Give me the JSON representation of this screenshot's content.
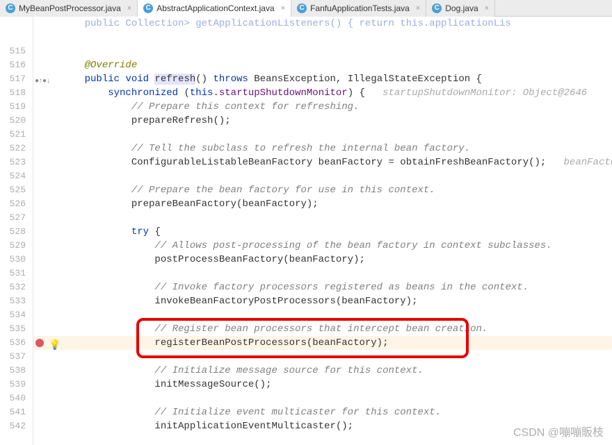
{
  "tabs": [
    {
      "label": "MyBeanPostProcessor.java",
      "active": false
    },
    {
      "label": "AbstractApplicationContext.java",
      "active": true
    },
    {
      "label": "FanfuApplicationTests.java",
      "active": false
    },
    {
      "label": "Dog.java",
      "active": false
    }
  ],
  "lines": {
    "start": 515,
    "end": 542
  },
  "code": {
    "l513_partial": "public Collection<ApplicationListener<?>> getApplicationListeners() { return this.applicationLis",
    "ann_override": "@Override",
    "refresh_sig_pre": "public void ",
    "refresh_word": "refresh",
    "refresh_sig_post": "() throws BeansException, IllegalStateException {",
    "sync_pre": "synchronized (",
    "sync_this": "this",
    "sync_field": ".startupShutdownMonitor",
    "sync_post": ") {",
    "sync_hint": "   startupShutdownMonitor: Object@2646",
    "c_prepare_ctx": "// Prepare this context for refreshing.",
    "prepareRefresh": "prepareRefresh();",
    "c_tell_subclass": "// Tell the subclass to refresh the internal bean factory.",
    "obtain_line": "ConfigurableListableBeanFactory beanFactory = obtainFreshBeanFactory();",
    "obtain_hint": "   beanFactory: \"o",
    "c_prepare_bf": "// Prepare the bean factory for use in this context.",
    "prepareBF": "prepareBeanFactory(beanFactory);",
    "try_kw": "try {",
    "c_allows": "// Allows post-processing of the bean factory in context subclasses.",
    "postProcessBF": "postProcessBeanFactory(beanFactory);",
    "c_invoke": "// Invoke factory processors registered as beans in the context.",
    "invokeBF": "invokeBeanFactoryPostProcessors(beanFactory);",
    "c_register": "// Register bean processors that intercept bean creation.",
    "registerBPP": "registerBeanPostProcessors(beanFactory);",
    "c_initmsg": "// Initialize message source for this context.",
    "initMsg": "initMessageSource();",
    "c_initevt": "// Initialize event multicaster for this context.",
    "initEvt": "initApplicationEventMulticaster();"
  },
  "watermark": "CSDN @嘣嘣販枝"
}
